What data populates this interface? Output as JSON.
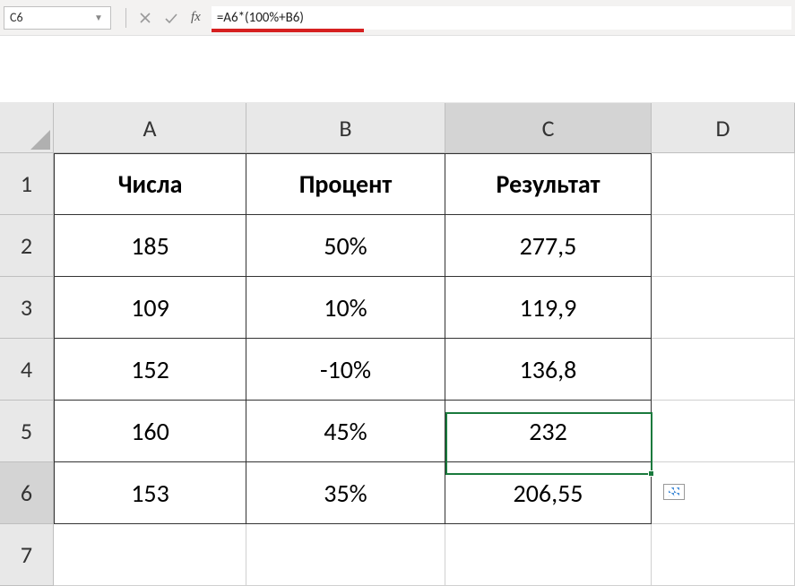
{
  "formula_bar": {
    "cell_reference": "C6",
    "fx_label": "fx",
    "formula": "=A6*(100%+B6)"
  },
  "columns": [
    "A",
    "B",
    "C",
    "D"
  ],
  "rows": [
    "1",
    "2",
    "3",
    "4",
    "5",
    "6",
    "7"
  ],
  "headers": {
    "col_a": "Числа",
    "col_b": "Процент",
    "col_c": "Результат"
  },
  "data": [
    {
      "a": "185",
      "b": "50%",
      "c": "277,5"
    },
    {
      "a": "109",
      "b": "10%",
      "c": "119,9"
    },
    {
      "a": "152",
      "b": "-10%",
      "c": "136,8"
    },
    {
      "a": "160",
      "b": "45%",
      "c": "232"
    },
    {
      "a": "153",
      "b": "35%",
      "c": "206,55"
    }
  ],
  "selected_cell": "C6"
}
